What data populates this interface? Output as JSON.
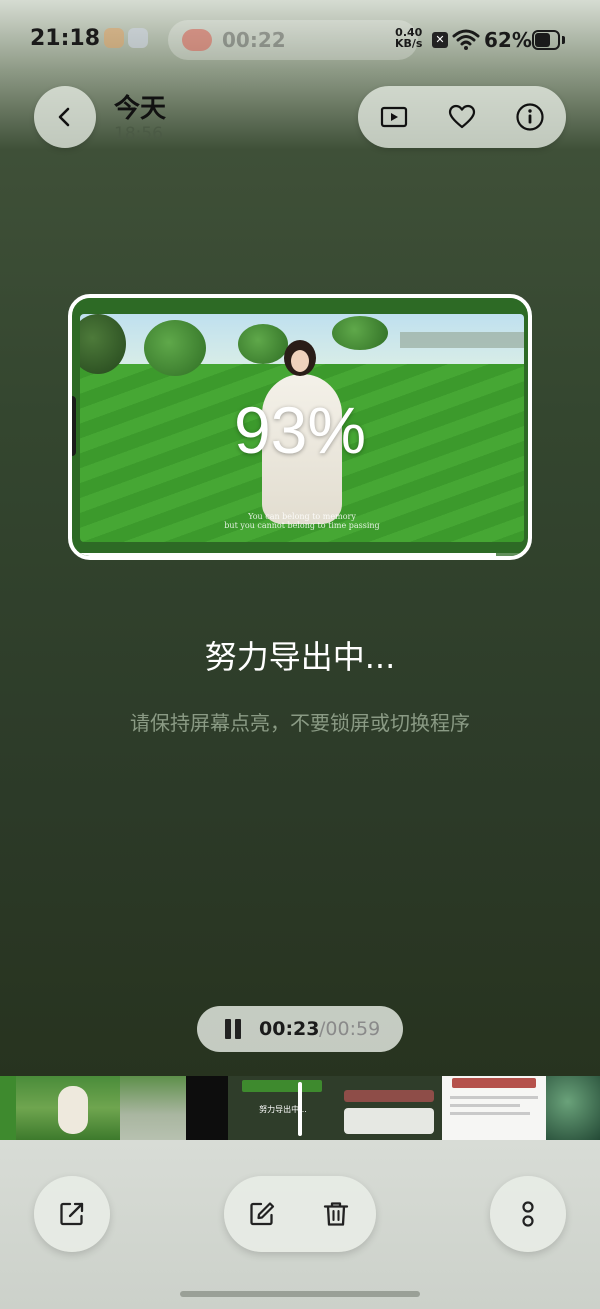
{
  "status_bar": {
    "time": "21:18",
    "recording_timer": "00:22",
    "net_speed_value": "0.40",
    "net_speed_unit": "KB/s",
    "battery_percent": "62%"
  },
  "header": {
    "title": "今天",
    "subtitle": "18:56",
    "icons": [
      "back-icon",
      "play-icon",
      "heart-icon",
      "info-icon"
    ]
  },
  "export": {
    "progress_percent": 93,
    "progress_label": "93%",
    "status_title": "努力导出中...",
    "hint": "请保持屏幕点亮，不要锁屏或切换程序",
    "preview_caption_line1": "You can belong to memory",
    "preview_caption_line2": "but you cannot belong to time passing"
  },
  "playback": {
    "current_time": "00:23",
    "total_time": "/00:59",
    "state_icon": "pause-icon"
  },
  "filmstrip_preview_text": "努力导出中...",
  "bottom_bar": {
    "icons": [
      "share-icon",
      "edit-icon",
      "delete-icon",
      "more-icon"
    ]
  },
  "colors": {
    "background_top": "#d6dcd2",
    "background_main": "#34462f",
    "hint_text": "#8a9a84",
    "pill_bg": "#e8ece6"
  }
}
